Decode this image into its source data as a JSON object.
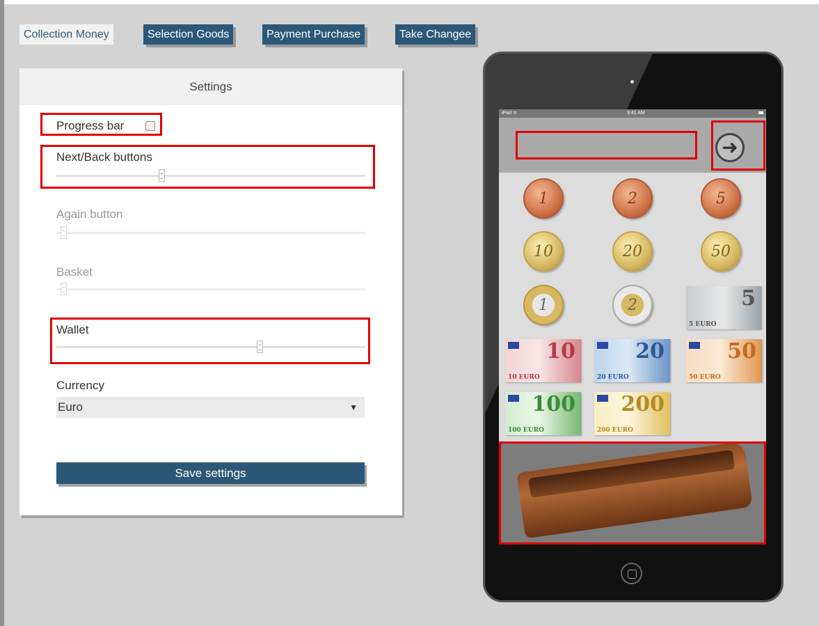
{
  "nav": {
    "tabs": [
      {
        "label": "Collection Money",
        "active": false
      },
      {
        "label": "Selection Goods",
        "active": true
      },
      {
        "label": "Payment Purchase",
        "active": true
      },
      {
        "label": "Take Changee",
        "active": true
      }
    ]
  },
  "settings": {
    "title": "Settings",
    "progress_bar": {
      "label": "Progress bar",
      "checked": false
    },
    "next_back": {
      "label": "Next/Back buttons",
      "level": 0.34
    },
    "again": {
      "label": "Again button",
      "level": 0.0,
      "disabled": true
    },
    "basket": {
      "label": "Basket",
      "level": 0.0,
      "disabled": true
    },
    "wallet": {
      "label": "Wallet",
      "level": 0.66
    },
    "currency": {
      "label": "Currency",
      "value": "Euro"
    },
    "save_label": "Save settings"
  },
  "tablet": {
    "status_left": "iPad ᯤ",
    "status_time": "9:41 AM",
    "arrow_glyph": "➜",
    "coins": [
      {
        "value": "1",
        "kind": "copper"
      },
      {
        "value": "2",
        "kind": "copper"
      },
      {
        "value": "5",
        "kind": "copper"
      },
      {
        "value": "10",
        "kind": "gold"
      },
      {
        "value": "20",
        "kind": "gold"
      },
      {
        "value": "50",
        "kind": "gold"
      },
      {
        "value": "1",
        "kind": "bimetal1"
      },
      {
        "value": "2",
        "kind": "bimetal2"
      }
    ],
    "notes": [
      {
        "value": "5",
        "small": "5 EURO"
      },
      {
        "value": "10",
        "small": "10 EURO"
      },
      {
        "value": "20",
        "small": "20 EURO"
      },
      {
        "value": "50",
        "small": "50 EURO"
      },
      {
        "value": "100",
        "small": "100 EURO"
      },
      {
        "value": "200",
        "small": "200 EURO"
      }
    ]
  },
  "colors": {
    "accent": "#2b5878",
    "highlight": "#e00000",
    "background": "#d3d3d3"
  }
}
